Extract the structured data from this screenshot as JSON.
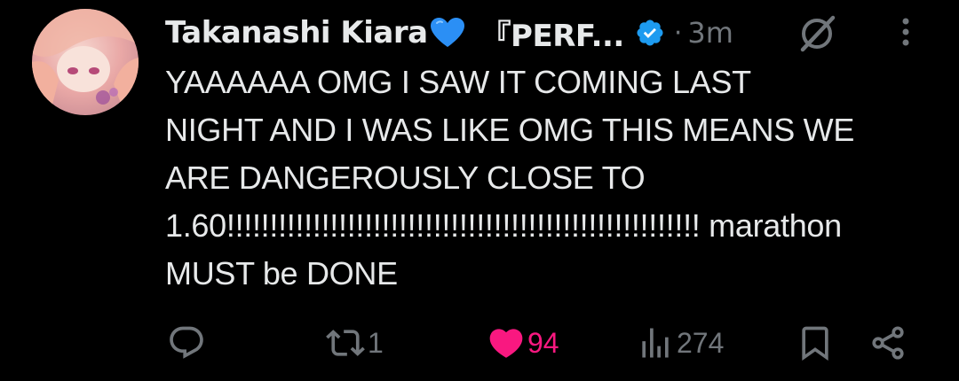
{
  "author": {
    "display_name": "Takanashi Kiara",
    "name_suffix": "『PERF...",
    "verified": true,
    "timestamp": "3m",
    "separator": "·"
  },
  "tweet": {
    "lines": [
      "YAAAAAA OMG I SAW IT COMING LAST",
      "NIGHT AND I WAS LIKE OMG THIS MEANS WE",
      "ARE DANGEROUSLY CLOSE TO",
      "1.60!!!!!!!!!!!!!!!!!!!!!!!!!!!!!!!!!!!!!!!!!!!!!!!!!!!!!!! marathon",
      "MUST be DONE"
    ]
  },
  "actions": {
    "reply_count": "",
    "retweet_count": "1",
    "like_count": "94",
    "views_count": "274",
    "liked": true
  },
  "colors": {
    "background": "#000000",
    "text": "#e7e9ea",
    "muted": "#71767b",
    "like": "#f91880",
    "verified": "#1d9bf0",
    "heart_emoji": "#2b8ff5"
  },
  "icons": {
    "avatar": "avatar-image",
    "heart_emoji": "blue-heart-emoji",
    "verified": "verified-badge-icon",
    "grok": "grok-icon",
    "more": "more-vertical-icon",
    "reply": "reply-icon",
    "retweet": "retweet-icon",
    "like": "like-heart-icon",
    "views": "views-icon",
    "bookmark": "bookmark-icon",
    "share": "share-icon"
  }
}
